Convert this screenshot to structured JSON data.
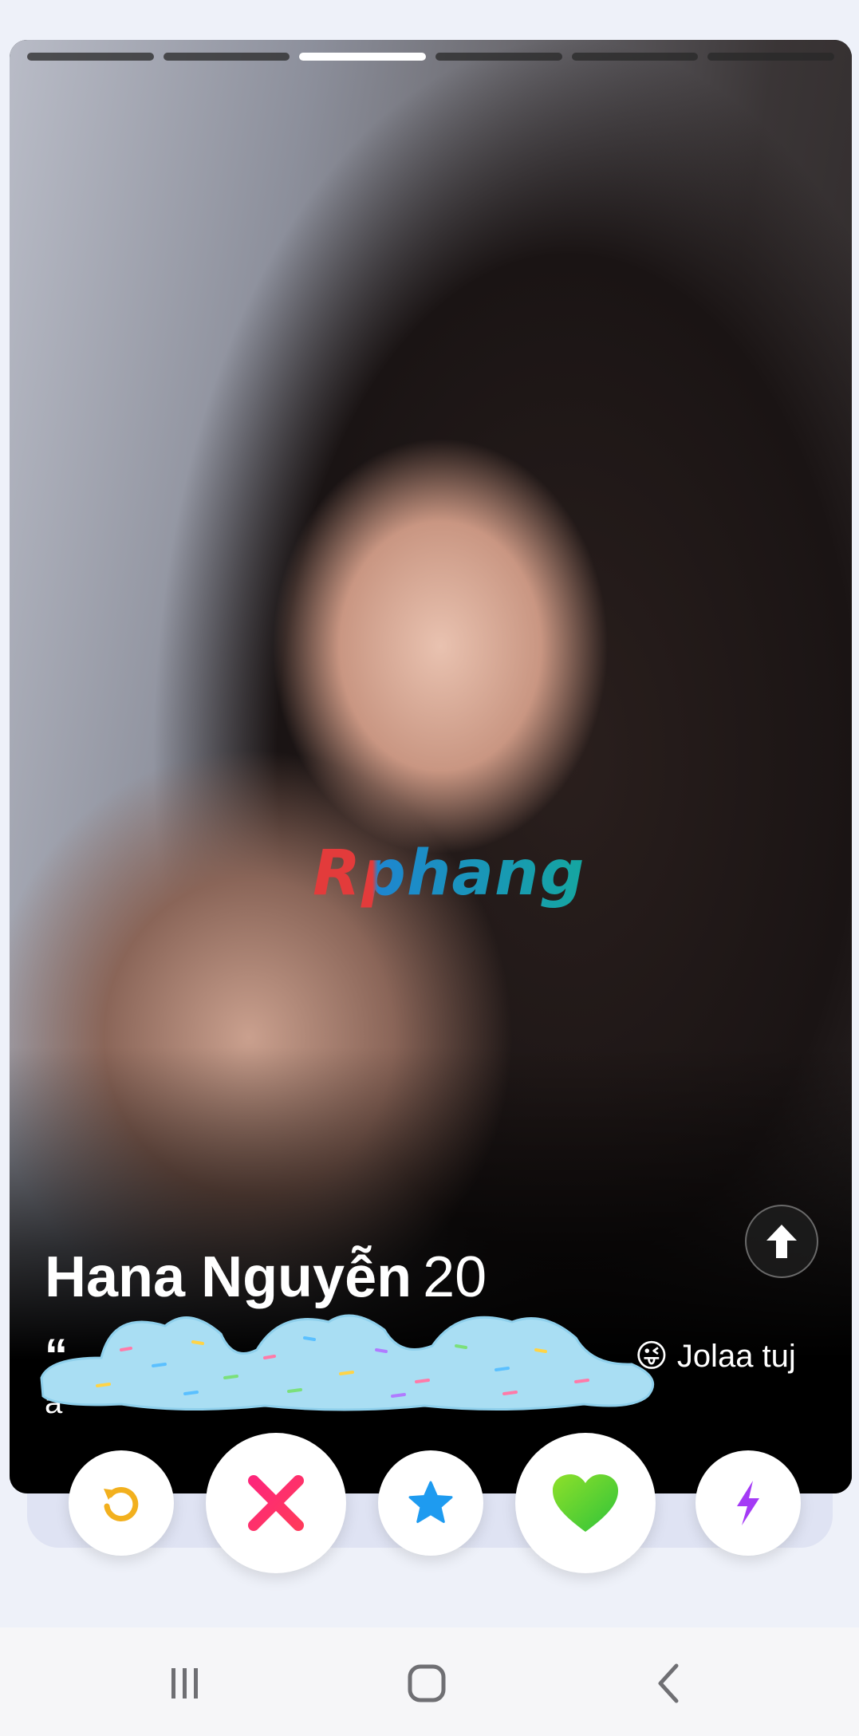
{
  "profile": {
    "name": "Hana Nguyễn",
    "age": "20",
    "bio_quote_mark": "“",
    "bio_visible_tail": "😜 Jolaa tuj",
    "bio_line2": "á",
    "photo_count": 6,
    "active_photo_index": 2
  },
  "watermark": {
    "text": "Rphang"
  },
  "icons": {
    "info": "arrow-up-icon",
    "rewind": "rewind-icon",
    "nope": "close-x-icon",
    "super_like": "star-icon",
    "like": "heart-icon",
    "boost": "lightning-icon"
  },
  "colors": {
    "rewind": "#f2b01e",
    "nope": "#fd267a",
    "super_like": "#1e9bf0",
    "like": "#6ad012",
    "boost": "#a43af5",
    "background": "#eef1f9"
  },
  "system_nav": {
    "recents": "recents-icon",
    "home": "home-icon",
    "back": "back-icon"
  }
}
